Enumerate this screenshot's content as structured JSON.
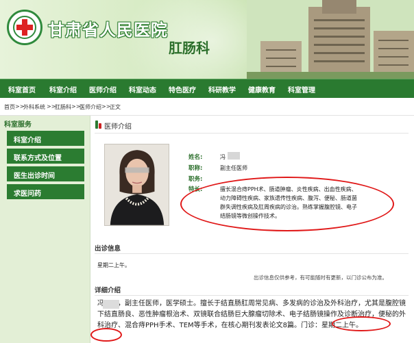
{
  "header": {
    "hospital_name": "甘肃省人民医院",
    "department": "肛肠科"
  },
  "nav": {
    "items": [
      "科室首页",
      "科室介绍",
      "医师介绍",
      "科室动态",
      "特色医疗",
      "科研教学",
      "健康教育",
      "科室管理"
    ]
  },
  "breadcrumb": {
    "items": [
      "首页",
      ">>",
      "外科系统",
      ">>",
      "肛肠科",
      ">>",
      "医师介绍",
      ">>",
      "正文"
    ]
  },
  "sidebar": {
    "title": "科室服务",
    "items": [
      "科室介绍",
      "联系方式及位置",
      "医生出诊时间",
      "求医问药"
    ]
  },
  "main": {
    "section_title": "医师介绍",
    "profile": {
      "name_label": "姓名:",
      "name_value": "冯",
      "title_label": "职称:",
      "title_value": "副主任医师",
      "duty_label": "职务:",
      "duty_value": "",
      "specialty_label": "特长:",
      "specialty_value": "擅长混合痔PPH术、肠道肿瘤、炎性疾病、出血性疾病、动力障碍性疾病、家族遗传性疾病、腹泻、便秘、肠道菌群失调性疾病及肛周疾病的诊治。熟练掌握腹腔镜、电子结肠镜等微创操作技术。"
    },
    "schedule_title": "出诊信息",
    "schedule_value": "星期二上午。",
    "schedule_note": "出诊信息仅供参考，有可能随时有更新，以门诊公布为准。",
    "detail_title": "详细介绍",
    "detail_text": "冯　　，副主任医师，医学硕士。擅长于结直肠肛周常见病、多发病的诊治及外科治疗，尤其是腹腔镜下结直肠良、恶性肿瘤根治术、双镜联合结肠巨大腺瘤切除术、电子结肠镜操作及诊断治疗，便秘的外科治疗、混合痔PPH手术、TEM等手术，在核心期刊发表论文8篇。门诊：星期二上午。"
  },
  "colors": {
    "nav_green": "#2a7a30",
    "label_green": "#2a6e2a",
    "highlight_red": "#e01818"
  }
}
